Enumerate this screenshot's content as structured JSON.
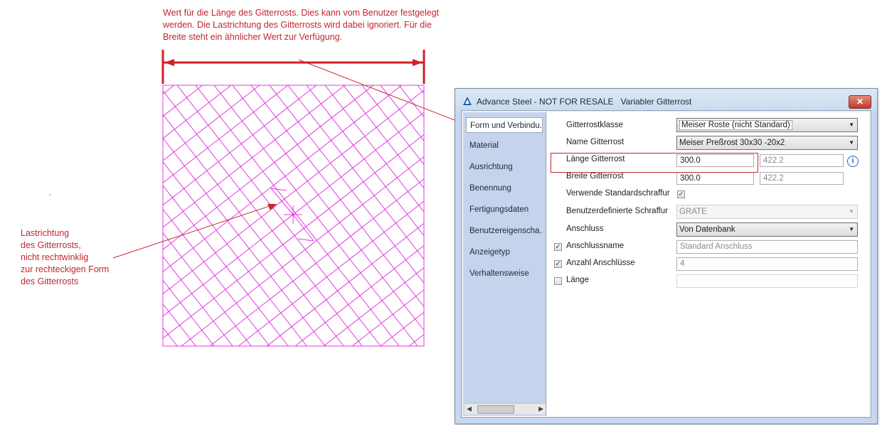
{
  "annotations": {
    "top_note": "Wert für die Länge des Gitterrosts. Dies kann vom Benutzer festgelegt werden. Die Lastrichtung des Gitterrosts wird dabei ignoriert. Für die Breite steht ein ähnlicher Wert zur Verfügung.",
    "left_note_lines": [
      "Lastrichtung",
      "des Gitterrosts,",
      "nicht rechtwinklig",
      "zur rechteckigen Form",
      "des Gitterrosts"
    ]
  },
  "colors": {
    "annotation": "#c0282d",
    "hatch": "#e23be0",
    "dialog_frame": "#c6d8ee",
    "nav_bg": "#c5d4ec"
  },
  "dialog": {
    "app_name": "Advance Steel - NOT FOR RESALE",
    "title": "Variabler Gitterrost",
    "close_glyph": "✕",
    "nav_items": [
      "Form und Verbindu...",
      "Material",
      "Ausrichtung",
      "Benennung",
      "Fertigungsdaten",
      "Benutzereigenscha...",
      "Anzeigetyp",
      "Verhaltensweise"
    ],
    "selected_nav": "Form und Verbindu...",
    "fields": {
      "gitterrostklasse": {
        "label": "Gitterrostklasse",
        "value": "Meiser Roste (nicht Standard)"
      },
      "name_gitterrost": {
        "label": "Name Gitterrost",
        "value": "Meiser Preßrost 30x30 -20x2"
      },
      "laenge_gitterrost": {
        "label": "Länge Gitterrost",
        "value": "300.0",
        "secondary": "422.2"
      },
      "breite_gitterrost": {
        "label": "Breite Gitterrost",
        "value": "300.0",
        "secondary": "422.2"
      },
      "verwende_standardschraffur": {
        "label": "Verwende Standardschraffur",
        "checked": true
      },
      "benutzerdefinierte_schraffur": {
        "label": "Benutzerdefinierte Schraffur",
        "value": "GRATE"
      },
      "anschluss": {
        "label": "Anschluss",
        "value": "Von Datenbank"
      },
      "anschlussname": {
        "label": "Anschlussname",
        "placeholder": "Standard Anschluss",
        "checked": true
      },
      "anzahl_anschluesse": {
        "label": "Anzahl Anschlüsse",
        "value": "4",
        "checked": true
      },
      "laenge": {
        "label": "Länge",
        "value": "",
        "checked": false
      }
    }
  },
  "icons": {
    "app": "advance-steel-logo-icon",
    "info": "info-icon",
    "dropdown": "chevron-down-icon",
    "scroll_left": "arrow-left-icon",
    "scroll_right": "arrow-right-icon",
    "check": "checkmark-icon"
  }
}
